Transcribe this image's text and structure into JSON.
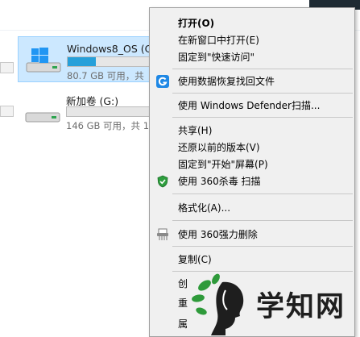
{
  "explorer": {
    "drives": [
      {
        "name": "Windows8_OS (C:",
        "size_text": "80.7 GB 可用，共",
        "used_fraction": 0.3,
        "icon": "windows-drive-icon",
        "selected": true
      },
      {
        "name": "新加卷 (G:)",
        "size_text": "146 GB 可用，共 1",
        "used_fraction": 0.0,
        "icon": "drive-icon",
        "selected": false
      }
    ]
  },
  "context_menu": {
    "items": [
      {
        "label": "打开(O)",
        "bold": true
      },
      {
        "label": "在新窗口中打开(E)"
      },
      {
        "label": "固定到\"快速访问\""
      },
      {
        "label": "使用数据恢复找回文件",
        "icon": "data-recovery-icon"
      },
      {
        "label": "使用 Windows Defender扫描..."
      },
      {
        "label": "共享(H)"
      },
      {
        "label": "还原以前的版本(V)"
      },
      {
        "label": "固定到\"开始\"屏幕(P)"
      },
      {
        "label": "使用 360杀毒 扫描",
        "icon": "shield-icon"
      },
      {
        "label": "格式化(A)..."
      },
      {
        "label": "使用 360强力删除",
        "icon": "shredder-icon"
      },
      {
        "label": "复制(C)"
      },
      {
        "label": "创"
      },
      {
        "label": "重"
      },
      {
        "label": "属"
      }
    ]
  },
  "watermark": {
    "text": "学知网"
  },
  "colors": {
    "menu_bg": "#f0f0f0",
    "selection_bg": "#cce8ff",
    "selection_border": "#99d1ff",
    "bar_fill": "#26a0da",
    "watermark_green": "#2e9a3a"
  }
}
